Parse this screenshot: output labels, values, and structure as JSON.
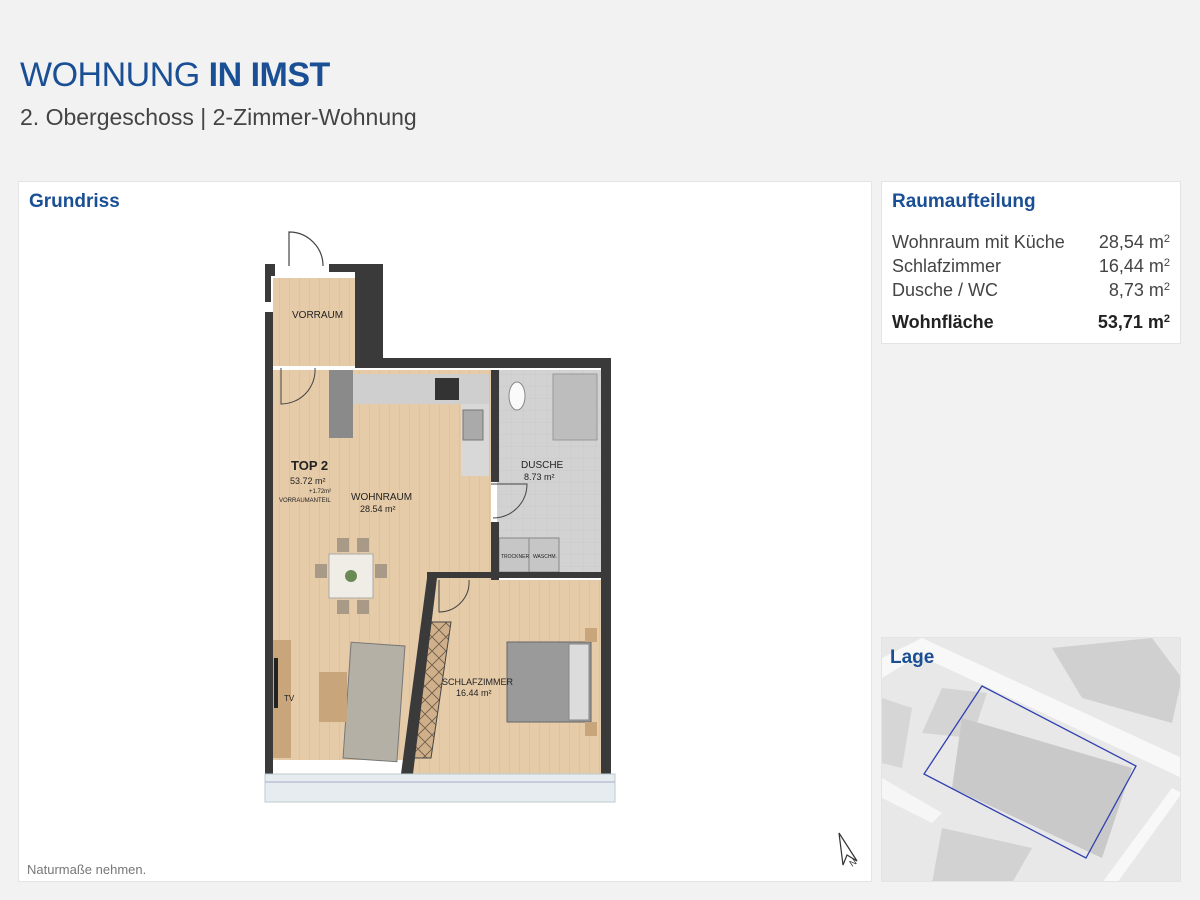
{
  "header": {
    "title_light": "WOHNUNG",
    "title_bold": "IN IMST",
    "subtitle": "2. Obergeschoss | 2-Zimmer-Wohnung"
  },
  "plan": {
    "heading": "Grundriss",
    "note": "Naturmaße nehmen.",
    "labels": {
      "vorraum": "VORRAUM",
      "top": "TOP 2",
      "top_area": "53.72 m²",
      "top_extra": "+1.72m²",
      "top_extra_label": "VORRAUMANTEIL",
      "wohnraum": "WOHNRAUM",
      "wohnraum_area": "28.54 m²",
      "dusche": "DUSCHE",
      "dusche_area": "8.73 m²",
      "trockner": "TROCKNER",
      "waschm": "WASCHM.",
      "schlafzimmer": "SCHLAFZIMMER",
      "schlafzimmer_area": "16.44 m²",
      "tv": "TV"
    }
  },
  "rooms": {
    "heading": "Raumaufteilung",
    "items": [
      {
        "name": "Wohnraum mit Küche",
        "area": "28,54 m",
        "unit_sup": "2"
      },
      {
        "name": "Schlafzimmer",
        "area": "16,44 m",
        "unit_sup": "2"
      },
      {
        "name": "Dusche / WC",
        "area": "8,73 m",
        "unit_sup": "2"
      }
    ],
    "total": {
      "name": "Wohnfläche",
      "area": "53,71 m",
      "unit_sup": "2"
    }
  },
  "map": {
    "heading": "Lage"
  },
  "icons": {
    "north": "north-arrow-icon"
  },
  "colors": {
    "brand": "#1a4f95",
    "wall": "#3a3a3a",
    "wood": "#e3c8a5",
    "tile": "#d0d0d0"
  }
}
